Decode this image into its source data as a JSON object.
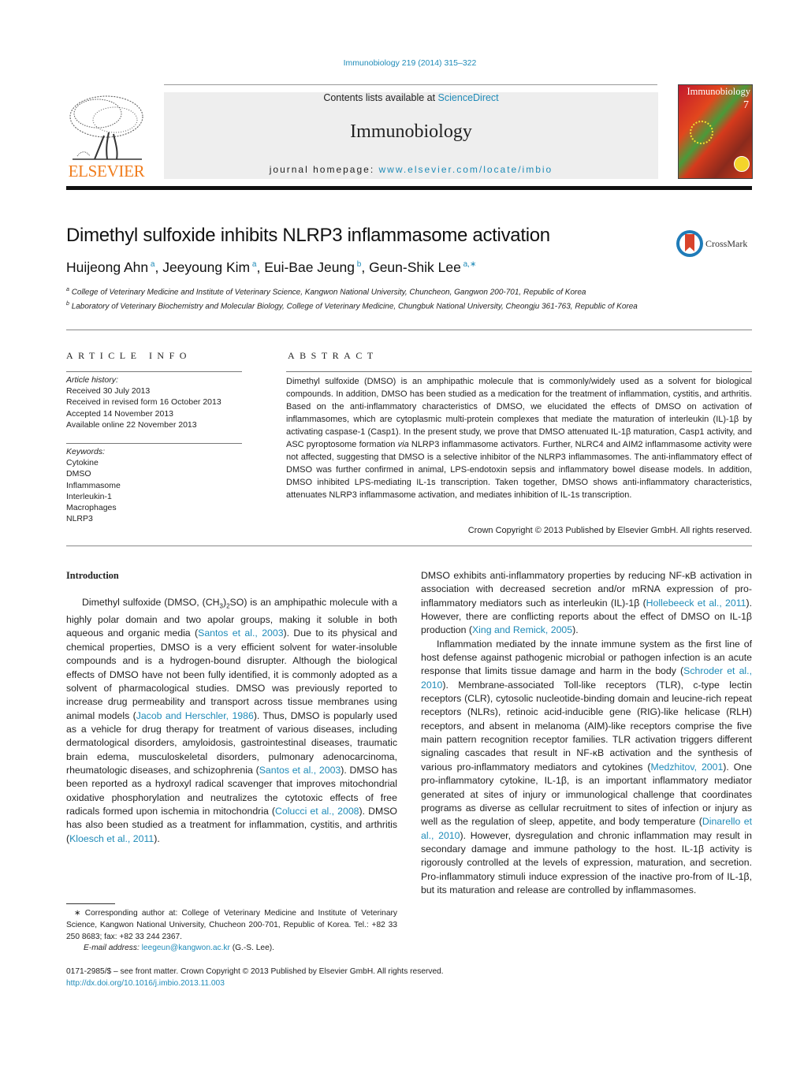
{
  "header": {
    "journal_ref": "Immunobiology 219 (2014) 315–322",
    "contents_prefix": "Contents lists available at ",
    "contents_link": "ScienceDirect",
    "journal_name": "Immunobiology",
    "homepage_prefix": "journal homepage: ",
    "homepage_link": "www.elsevier.com/locate/imbio",
    "publisher_logo": "ELSEVIER",
    "cover_title": "Immunobiology",
    "cover_issue": "7",
    "colors": {
      "link": "#1f8bb8",
      "publisher": "#f07c1c"
    }
  },
  "article": {
    "title": "Dimethyl sulfoxide inhibits NLRP3 inflammasome activation",
    "crossmark_label": "CrossMark",
    "authors": [
      {
        "name": "Huijeong Ahn",
        "sup": "a",
        "sep": ", "
      },
      {
        "name": "Jeeyoung Kim",
        "sup": "a",
        "sep": ", "
      },
      {
        "name": "Eui-Bae Jeung",
        "sup": "b",
        "sep": ", "
      },
      {
        "name": "Geun-Shik Lee",
        "sup": "a,∗",
        "sep": ""
      }
    ],
    "affiliations": [
      {
        "sup": "a",
        "text": "College of Veterinary Medicine and Institute of Veterinary Science, Kangwon National University, Chuncheon, Gangwon 200-701, Republic of Korea"
      },
      {
        "sup": "b",
        "text": "Laboratory of Veterinary Biochemistry and Molecular Biology, College of Veterinary Medicine, Chungbuk National University, Cheongju 361-763, Republic of Korea"
      }
    ]
  },
  "article_info": {
    "heading": "ARTICLE INFO",
    "history_label": "Article history:",
    "history": [
      "Received 30 July 2013",
      "Received in revised form 16 October 2013",
      "Accepted 14 November 2013",
      "Available online 22 November 2013"
    ],
    "keywords_label": "Keywords:",
    "keywords": [
      "Cytokine",
      "DMSO",
      "Inflammasome",
      "Interleukin-1",
      "Macrophages",
      "NLRP3"
    ]
  },
  "abstract": {
    "heading": "ABSTRACT",
    "text_1": "Dimethyl sulfoxide (DMSO) is an amphipathic molecule that is commonly/widely used as a solvent for biological compounds. In addition, DMSO has been studied as a medication for the treatment of inflammation, cystitis, and arthritis. Based on the anti-inflammatory characteristics of DMSO, we elucidated the effects of DMSO on activation of inflammasomes, which are cytoplasmic multi-protein complexes that mediate the maturation of interleukin (IL)-1β by activating caspase-1 (Casp1). In the present study, we prove that DMSO attenuated IL-1β maturation, Casp1 activity, and ASC pyroptosome formation ",
    "text_via": "via",
    "text_2": " NLRP3 inflammasome activators. Further, NLRC4 and AIM2 inflammasome activity were not affected, suggesting that DMSO is a selective inhibitor of the NLRP3 inflammasomes. The anti-inflammatory effect of DMSO was further confirmed in animal, LPS-endotoxin sepsis and inflammatory bowel disease models. In addition, DMSO inhibited LPS-mediating IL-1s transcription. Taken together, DMSO shows anti-inflammatory characteristics, attenuates NLRP3 inflammasome activation, and mediates inhibition of IL-1s transcription.",
    "copyright": "Crown Copyright © 2013 Published by Elsevier GmbH. All rights reserved."
  },
  "body": {
    "intro_heading": "Introduction",
    "left_para": [
      {
        "t": "Dimethyl sulfoxide (DMSO, (CH"
      },
      {
        "sub": "3"
      },
      {
        "t": ")"
      },
      {
        "sub": "2"
      },
      {
        "t": "SO) is an amphipathic molecule with a highly polar domain and two apolar groups, making it soluble in both aqueous and organic media ("
      },
      {
        "link": "Santos et al., 2003"
      },
      {
        "t": "). Due to its physical and chemical properties, DMSO is a very efficient solvent for water-insoluble compounds and is a hydrogen-bound disrupter. Although the biological effects of DMSO have not been fully identified, it is commonly adopted as a solvent of pharmacological studies. DMSO was previously reported to increase drug permeability and transport across tissue membranes using animal models ("
      },
      {
        "link": "Jacob and Herschler, 1986"
      },
      {
        "t": "). Thus, DMSO is popularly used as a vehicle for drug therapy for treatment of various diseases, including dermatological disorders, amyloidosis, gastrointestinal diseases, traumatic brain edema, musculoskeletal disorders, pulmonary adenocarcinoma, rheumatologic diseases, and schizophrenia ("
      },
      {
        "link": "Santos et al., 2003"
      },
      {
        "t": "). DMSO has been reported as a hydroxyl radical scavenger that improves mitochondrial oxidative phosphorylation and neutralizes the cytotoxic effects of free radicals formed upon ischemia in mitochondria ("
      },
      {
        "link": "Colucci et al., 2008"
      },
      {
        "t": "). DMSO has also been studied as a treatment for inflammation, cystitis, and arthritis ("
      },
      {
        "link": "Kloesch et al., 2011"
      },
      {
        "t": ")."
      }
    ],
    "right_para_1": [
      {
        "t": "DMSO exhibits anti-inflammatory properties by reducing NF-κB activation in association with decreased secretion and/or mRNA expression of pro-inflammatory mediators such as interleukin (IL)-1β ("
      },
      {
        "link": "Hollebeeck et al., 2011"
      },
      {
        "t": "). However, there are conflicting reports about the effect of DMSO on IL-1β production ("
      },
      {
        "link": "Xing and Remick, 2005"
      },
      {
        "t": ")."
      }
    ],
    "right_para_2": [
      {
        "t": "Inflammation mediated by the innate immune system as the first line of host defense against pathogenic microbial or pathogen infection is an acute response that limits tissue damage and harm in the body ("
      },
      {
        "link": "Schroder et al., 2010"
      },
      {
        "t": "). Membrane-associated Toll-like receptors (TLR), c-type lectin receptors (CLR), cytosolic nucleotide-binding domain and leucine-rich repeat receptors (NLRs), retinoic acid-inducible gene (RIG)-like helicase (RLH) receptors, and absent in melanoma (AIM)-like receptors comprise the five main pattern recognition receptor families. TLR activation triggers different signaling cascades that result in NF-κB activation and the synthesis of various pro-inflammatory mediators and cytokines ("
      },
      {
        "link": "Medzhitov, 2001"
      },
      {
        "t": "). One pro-inflammatory cytokine, IL-1β, is an important inflammatory mediator generated at sites of injury or immunological challenge that coordinates programs as diverse as cellular recruitment to sites of infection or injury as well as the regulation of sleep, appetite, and body temperature ("
      },
      {
        "link": "Dinarello et al., 2010"
      },
      {
        "t": "). However, dysregulation and chronic inflammation may result in secondary damage and immune pathology to the host. IL-1β activity is rigorously controlled at the levels of expression, maturation, and secretion. Pro-inflammatory stimuli induce expression of the inactive pro-from of IL-1β, but its maturation and release are controlled by inflammasomes."
      }
    ]
  },
  "footnote": {
    "corresponding": "∗ Corresponding author at: College of Veterinary Medicine and Institute of Veterinary Science, Kangwon National University, Chucheon 200-701, Republic of Korea. Tel.: +82 33 250 8683; fax: +82 33 244 2367.",
    "email_label": "E-mail address: ",
    "email": "leegeun@kangwon.ac.kr",
    "email_suffix": " (G.-S. Lee)."
  },
  "front_matter": {
    "issn_line": "0171-2985/$ – see front matter. Crown Copyright © 2013 Published by Elsevier GmbH. All rights reserved.",
    "doi": "http://dx.doi.org/10.1016/j.imbio.2013.11.003"
  }
}
